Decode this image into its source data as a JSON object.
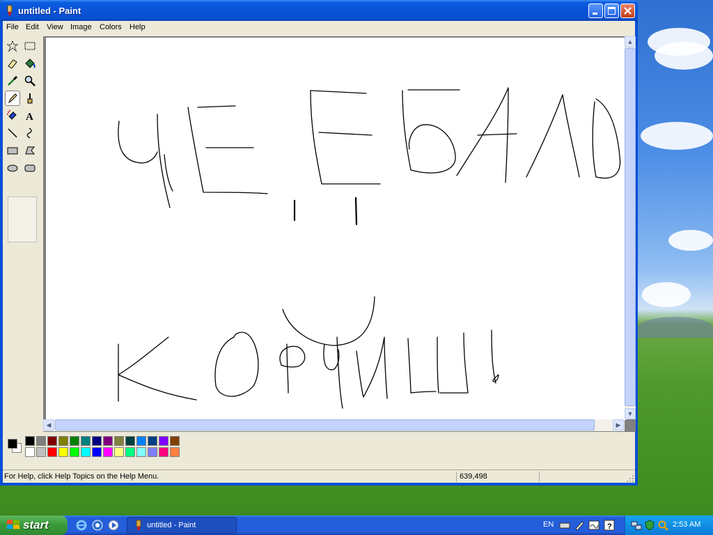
{
  "window": {
    "title": "untitled - Paint"
  },
  "menu": [
    "File",
    "Edit",
    "View",
    "Image",
    "Colors",
    "Help"
  ],
  "status": {
    "help_text": "For Help, click Help Topics on the Help Menu.",
    "coords": "639,498"
  },
  "taskbar": {
    "start_label": "start",
    "task_label": "untitled - Paint",
    "lang": "EN",
    "clock": "2:53 AM"
  },
  "palette": {
    "top": [
      "#000000",
      "#808080",
      "#800000",
      "#808000",
      "#008000",
      "#008080",
      "#000080",
      "#800080",
      "#808040",
      "#004040",
      "#0080ff",
      "#004080",
      "#8000ff",
      "#804000"
    ],
    "bottom": [
      "#ffffff",
      "#c0c0c0",
      "#ff0000",
      "#ffff00",
      "#00ff00",
      "#00ffff",
      "#0000ff",
      "#ff00ff",
      "#ffff80",
      "#00ff80",
      "#80ffff",
      "#8080ff",
      "#ff0080",
      "#ff8040"
    ],
    "foreground": "#000000",
    "background": "#ffffff"
  },
  "tools": [
    "free-select",
    "rect-select",
    "eraser",
    "fill",
    "color-picker",
    "magnifier",
    "pencil",
    "brush",
    "airbrush",
    "text",
    "line",
    "curve",
    "rectangle",
    "polygon",
    "ellipse",
    "rounded-rectangle"
  ],
  "active_tool": "pencil"
}
